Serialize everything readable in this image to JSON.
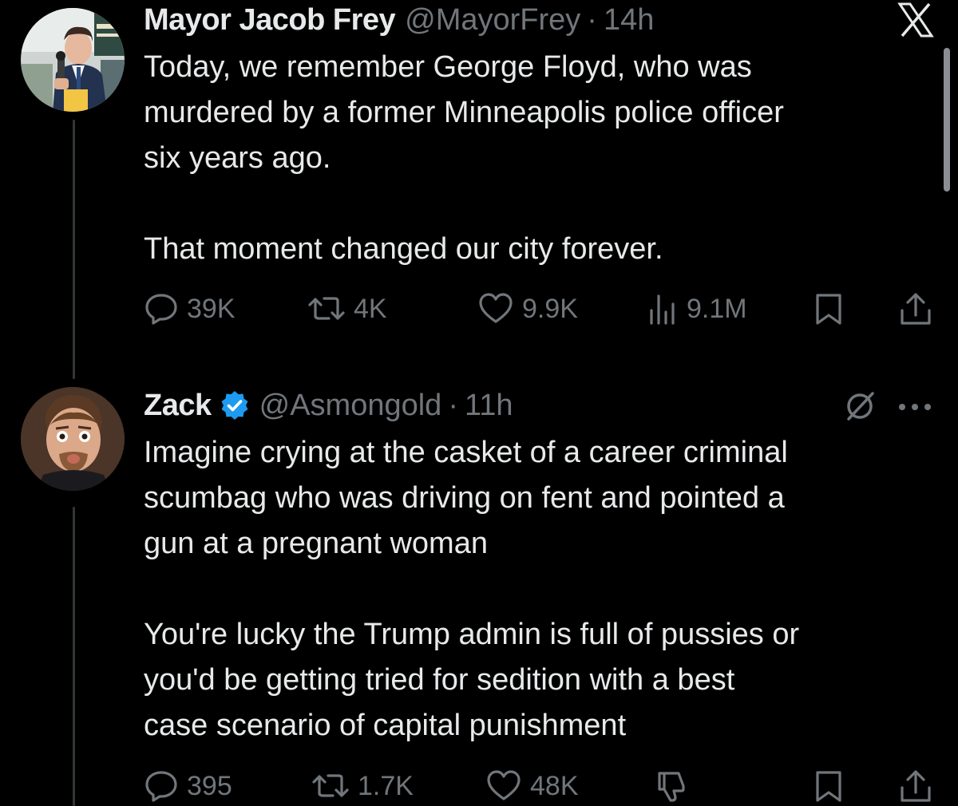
{
  "tweets": [
    {
      "name": "Mayor Jacob Frey",
      "handle": "@MayorFrey",
      "separator": "·",
      "time": "14h",
      "text": "Today, we remember George Floyd, who was\nmurdered by a former Minneapolis police officer\nsix years ago.\n\nThat moment changed our city forever.",
      "actions": {
        "replies": "39K",
        "reposts": "4K",
        "likes": "9.9K",
        "views": "9.1M"
      }
    },
    {
      "name": "Zack",
      "handle": "@Asmongold",
      "separator": "·",
      "time": "11h",
      "verified": true,
      "text": "Imagine crying at the casket of a career criminal\nscumbag who was driving on fent and pointed a\ngun at a pregnant woman\n\nYou're lucky the Trump admin is full of pussies or\nyou'd be getting tried for sedition with a best\ncase scenario of capital punishment",
      "actions": {
        "replies": "395",
        "reposts": "1.7K",
        "likes": "48K"
      }
    }
  ],
  "icons": {
    "close": "close-icon",
    "grok": "grok-icon",
    "more": "more-icon",
    "reply": "reply-icon",
    "repost": "repost-icon",
    "like": "like-icon",
    "views": "views-icon",
    "dislike": "dislike-icon",
    "bookmark": "bookmark-icon",
    "share": "share-icon"
  },
  "colors": {
    "background": "#000000",
    "text": "#e7e9ea",
    "muted": "#71767b",
    "verified": "#1d9bf0",
    "thread_line": "#333639"
  }
}
